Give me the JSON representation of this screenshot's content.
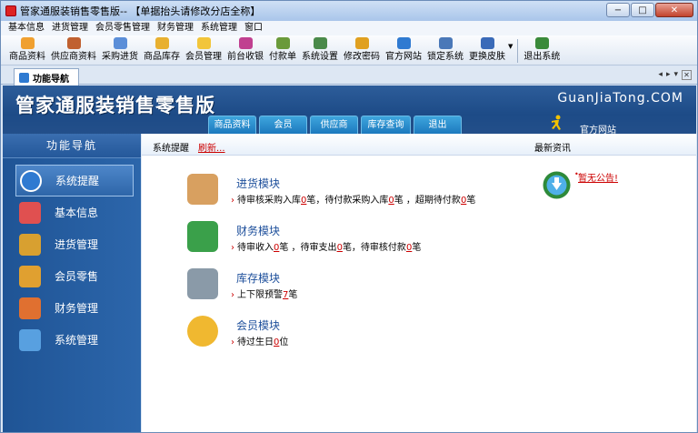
{
  "window": {
    "title": "管家通服装销售零售版-- 【单据抬头请修改分店全称】",
    "min": "−",
    "max": "□",
    "close": "✕"
  },
  "menu": [
    "基本信息",
    "进货管理",
    "会员零售管理",
    "财务管理",
    "系统管理",
    "窗口"
  ],
  "toolbar": [
    {
      "label": "商品资料",
      "icon": "goods-icon",
      "color": "#f0a030"
    },
    {
      "label": "供应商资料",
      "icon": "supplier-icon",
      "color": "#c06030"
    },
    {
      "label": "采购进货",
      "icon": "purchase-icon",
      "color": "#5b8ed8"
    },
    {
      "label": "商品库存",
      "icon": "stock-icon",
      "color": "#e8b030"
    },
    {
      "label": "会员管理",
      "icon": "member-icon",
      "color": "#f2c53a"
    },
    {
      "label": "前台收银",
      "icon": "cashier-icon",
      "color": "#c04090"
    },
    {
      "label": "付款单",
      "icon": "payment-icon",
      "color": "#6a9a3a"
    },
    {
      "label": "系统设置",
      "icon": "settings-icon",
      "color": "#4a8a4a"
    },
    {
      "label": "修改密码",
      "icon": "password-icon",
      "color": "#e0a020"
    },
    {
      "label": "官方网站",
      "icon": "website-icon",
      "color": "#2f7ad1"
    },
    {
      "label": "锁定系统",
      "icon": "lock-icon",
      "color": "#4a78b8"
    },
    {
      "label": "更换皮肤",
      "icon": "skin-icon",
      "color": "#3a6ab8"
    },
    {
      "label": "退出系统",
      "icon": "exit-icon",
      "color": "#3a8a3a"
    }
  ],
  "tab": {
    "label": "功能导航"
  },
  "banner": {
    "title": "管家通服装销售零售版",
    "site": "GuanJiaTong.COM",
    "official": "官方网站",
    "tabs": [
      "商品资料",
      "会员",
      "供应商",
      "库存查询",
      "退出"
    ]
  },
  "sidebar": {
    "title": "功能导航",
    "items": [
      {
        "label": "系统提醒",
        "icon": "info-icon",
        "color": "#2f7ad1"
      },
      {
        "label": "基本信息",
        "icon": "blocks-icon",
        "color": "#e05050"
      },
      {
        "label": "进货管理",
        "icon": "box-icon",
        "color": "#d8a030"
      },
      {
        "label": "会员零售",
        "icon": "box-open-icon",
        "color": "#e0a030"
      },
      {
        "label": "财务管理",
        "icon": "finance-icon",
        "color": "#e07030"
      },
      {
        "label": "系统管理",
        "icon": "chart-icon",
        "color": "#58a0e0"
      }
    ]
  },
  "main": {
    "header": {
      "title": "系统提醒",
      "refresh": "刷新...",
      "news": "最新资讯"
    },
    "news_link": "暂无公告!",
    "modules": [
      {
        "name": "进货模块",
        "icon": "purchase-box-icon",
        "color": "#d8a060",
        "parts": [
          "待审核采购入库",
          "0",
          "笔，待付款采购入库",
          "0",
          "笔 ，超期待付款",
          "0",
          "笔"
        ]
      },
      {
        "name": "财务模块",
        "icon": "dollar-icon",
        "color": "#3aa04a",
        "parts": [
          "待审收入",
          "0",
          "笔 ，待审支出",
          "0",
          "笔，待审核付款",
          "0",
          "笔"
        ]
      },
      {
        "name": "库存模块",
        "icon": "database-icon",
        "color": "#8a9aa8",
        "parts": [
          "上下限预警",
          "7",
          "笔"
        ]
      },
      {
        "name": "会员模块",
        "icon": "chat-icon",
        "color": "#f0b830",
        "parts": [
          "待过生日",
          "0",
          "位"
        ]
      }
    ]
  }
}
